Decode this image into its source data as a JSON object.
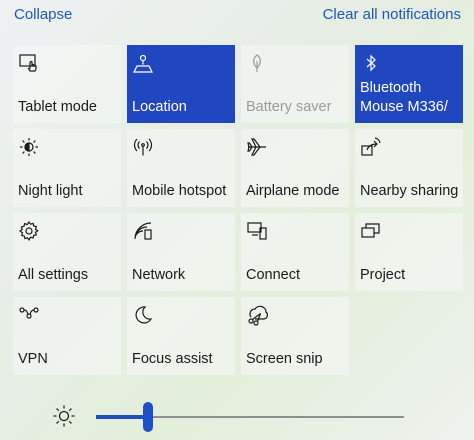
{
  "header": {
    "collapse_label": "Collapse",
    "clear_label": "Clear all notifications"
  },
  "tiles": [
    {
      "label": "Tablet mode",
      "icon": "tablet-mode-icon",
      "state": "off"
    },
    {
      "label": "Location",
      "icon": "location-icon",
      "state": "on"
    },
    {
      "label": "Battery saver",
      "icon": "battery-saver-icon",
      "state": "disabled"
    },
    {
      "label": "Bluetooth Mouse M336/",
      "icon": "bluetooth-icon",
      "state": "on"
    },
    {
      "label": "Night light",
      "icon": "night-light-icon",
      "state": "off"
    },
    {
      "label": "Mobile hotspot",
      "icon": "mobile-hotspot-icon",
      "state": "off"
    },
    {
      "label": "Airplane mode",
      "icon": "airplane-icon",
      "state": "off"
    },
    {
      "label": "Nearby sharing",
      "icon": "nearby-sharing-icon",
      "state": "off"
    },
    {
      "label": "All settings",
      "icon": "gear-icon",
      "state": "off"
    },
    {
      "label": "Network",
      "icon": "network-icon",
      "state": "off"
    },
    {
      "label": "Connect",
      "icon": "connect-icon",
      "state": "off"
    },
    {
      "label": "Project",
      "icon": "project-icon",
      "state": "off"
    },
    {
      "label": "VPN",
      "icon": "vpn-icon",
      "state": "off"
    },
    {
      "label": "Focus assist",
      "icon": "moon-icon",
      "state": "off"
    },
    {
      "label": "Screen snip",
      "icon": "screen-snip-icon",
      "state": "off"
    }
  ],
  "brightness": {
    "icon": "brightness-icon",
    "level": 0.17
  },
  "colors": {
    "accent": "#2047c0",
    "link": "#1f57b8",
    "tile_bg": "#f2f5f2"
  }
}
